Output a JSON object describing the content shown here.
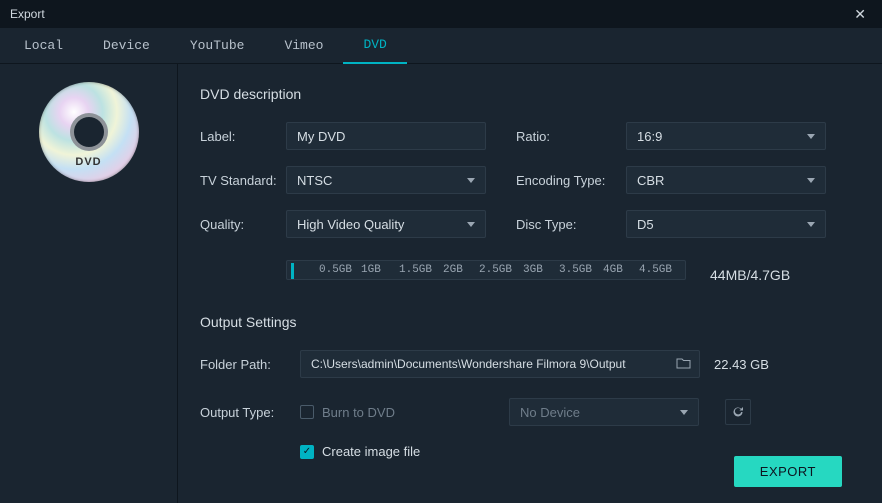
{
  "window": {
    "title": "Export",
    "close": "✕"
  },
  "tabs": {
    "local": "Local",
    "device": "Device",
    "youtube": "YouTube",
    "vimeo": "Vimeo",
    "dvd": "DVD"
  },
  "disc": {
    "label": "DVD"
  },
  "description": {
    "heading": "DVD description",
    "label_lbl": "Label:",
    "label_value": "My DVD",
    "ratio_lbl": "Ratio:",
    "ratio_value": "16:9",
    "tvstandard_lbl": "TV Standard:",
    "tvstandard_value": "NTSC",
    "encoding_lbl": "Encoding Type:",
    "encoding_value": "CBR",
    "quality_lbl": "Quality:",
    "quality_value": "High Video Quality",
    "disctype_lbl": "Disc Type:",
    "disctype_value": "D5"
  },
  "sizebar": {
    "t1": "0.5GB",
    "t2": "1GB",
    "t3": "1.5GB",
    "t4": "2GB",
    "t5": "2.5GB",
    "t6": "3GB",
    "t7": "3.5GB",
    "t8": "4GB",
    "t9": "4.5GB",
    "readout": "44MB/4.7GB"
  },
  "output": {
    "heading": "Output Settings",
    "folder_lbl": "Folder Path:",
    "folder_value": "C:\\Users\\admin\\Documents\\Wondershare Filmora 9\\Output",
    "free_space": "22.43 GB",
    "outputtype_lbl": "Output Type:",
    "burn_label": "Burn to DVD",
    "device_value": "No Device",
    "create_image_label": "Create image file"
  },
  "actions": {
    "export": "EXPORT"
  }
}
